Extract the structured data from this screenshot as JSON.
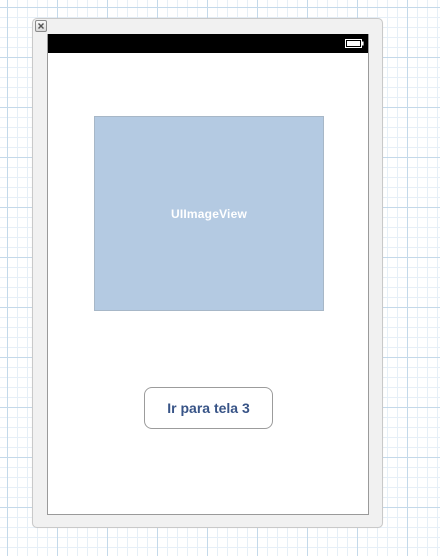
{
  "canvas": {
    "grid_minor_color": "#e6eff7",
    "grid_major_color": "#c4d9ea"
  },
  "scene": {
    "close_icon": "close-x-icon",
    "status_bar": {
      "background": "#000000",
      "battery_icon": "battery-full-icon"
    },
    "image_view": {
      "label": "UIImageView",
      "fill_color": "#b4cae2"
    },
    "button": {
      "label": "Ir para tela 3",
      "text_color": "#385487"
    }
  }
}
